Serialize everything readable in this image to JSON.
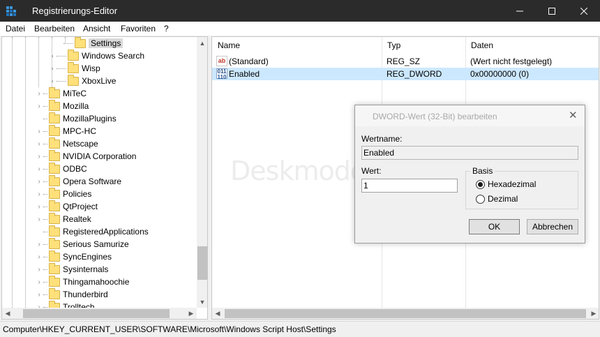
{
  "window": {
    "title": "Registrierungs-Editor",
    "icon": "registry-editor-icon",
    "controls": {
      "minimize": "minimize-icon",
      "maximize": "maximize-icon",
      "close": "close-icon"
    }
  },
  "menu": [
    "Datei",
    "Bearbeiten",
    "Ansicht",
    "Favoriten",
    "?"
  ],
  "tree": {
    "items": [
      "Settings",
      "Windows Search",
      "Wisp",
      "XboxLive",
      "MiTeC",
      "Mozilla",
      "MozillaPlugins",
      "MPC-HC",
      "Netscape",
      "NVIDIA Corporation",
      "ODBC",
      "Opera Software",
      "Policies",
      "QtProject",
      "Realtek",
      "RegisteredApplications",
      "Serious Samurize",
      "SyncEngines",
      "Sysinternals",
      "Thingamahoochie",
      "Thunderbird",
      "Trolltech"
    ],
    "selected": "Settings"
  },
  "values": {
    "columns": {
      "name": "Name",
      "type": "Typ",
      "data": "Daten"
    },
    "rows": [
      {
        "name": "(Standard)",
        "type": "REG_SZ",
        "data": "(Wert nicht festgelegt)",
        "icon": "ab-string-icon"
      },
      {
        "name": "Enabled",
        "type": "REG_DWORD",
        "data": "0x00000000 (0)",
        "icon": "binary-value-icon"
      }
    ],
    "selected_color": "#cce8ff"
  },
  "watermark": "Deskmodder.de",
  "statusbar": "Computer\\HKEY_CURRENT_USER\\SOFTWARE\\Microsoft\\Windows Script Host\\Settings",
  "dialog": {
    "title": "DWORD-Wert (32-Bit) bearbeiten",
    "name_label": "Wertname:",
    "name_value": "Enabled",
    "value_label": "Wert:",
    "value_value": "1",
    "base_label": "Basis",
    "radio_hex": "Hexadezimal",
    "radio_dec": "Dezimal",
    "selected_base": "Hexadezimal",
    "ok": "OK",
    "cancel": "Abbrechen"
  }
}
